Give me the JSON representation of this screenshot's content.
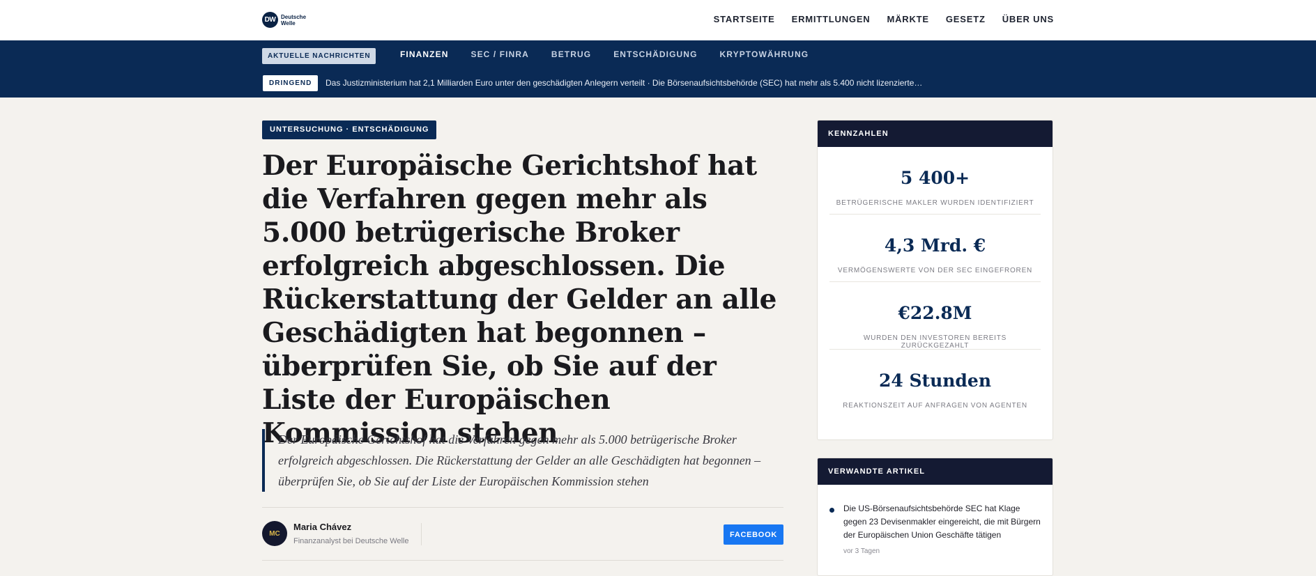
{
  "brand": {
    "mark": "DW",
    "name_line1": "Deutsche",
    "name_line2": "Welle",
    "color": "#0a2244"
  },
  "topnav": [
    {
      "label": "STARTSEITE"
    },
    {
      "label": "ERMITTLUNGEN"
    },
    {
      "label": "MÄRKTE"
    },
    {
      "label": "GESETZ"
    },
    {
      "label": "ÜBER UNS"
    }
  ],
  "subnav": {
    "latest_label": "AKTUELLE NACHRICHTEN",
    "categories": [
      {
        "label": "FINANZEN",
        "active": true
      },
      {
        "label": "SEC / FINRA"
      },
      {
        "label": "BETRUG"
      },
      {
        "label": "ENTSCHÄDIGUNG"
      },
      {
        "label": "KRYPTOWÄHRUNG"
      }
    ],
    "urgent_label": "DRINGEND",
    "ticker": "Das Justizministerium hat 2,1 Milliarden Euro unter den geschädigten Anlegern verteilt · Die Börsenaufsichtsbehörde (SEC) hat mehr als 5.400 nicht lizenzierte…"
  },
  "article": {
    "kicker": "UNTERSUCHUNG · ENTSCHÄDIGUNG",
    "headline": "Der Europäische Gerichtshof hat die Verfahren gegen mehr als 5.000 betrügerische Broker erfolgreich abgeschlossen. Die Rückerstattung der Gelder an alle Geschädigten hat begonnen – überprüfen Sie, ob Sie auf der Liste der Europäischen Kommission stehen",
    "lede": "Der Europäische Gerichtshof hat die Verfahren gegen mehr als 5.000 betrügerische Broker erfolgreich abgeschlossen. Die Rückerstattung der Gelder an alle Geschädigten hat begonnen – überprüfen Sie, ob Sie auf der Liste der Europäischen Kommission stehen",
    "author": {
      "initials": "MC",
      "name": "Maria Chávez",
      "role": "Finanzanalyst bei Deutsche Welle"
    },
    "share_facebook": "FACEBOOK"
  },
  "sidebar": {
    "stats_title": "KENNZAHLEN",
    "stats": [
      {
        "value": "5 400+",
        "label": "BETRÜGERISCHE MAKLER WURDEN IDENTIFIZIERT"
      },
      {
        "value": "4,3 Mrd. €",
        "label": "VERMÖGENSWERTE VON DER SEC EINGEFROREN"
      },
      {
        "value": "€22.8M",
        "label": "WURDEN DEN INVESTOREN BEREITS ZURÜCKGEZAHLT"
      },
      {
        "value": "24 Stunden",
        "label": "REAKTIONSZEIT AUF ANFRAGEN VON AGENTEN"
      }
    ],
    "related_title": "VERWANDTE ARTIKEL",
    "related": [
      {
        "title": "Die US-Börsenaufsichtsbehörde SEC hat Klage gegen 23 Devisenmakler eingereicht, die mit Bürgern der Europäischen Union Geschäfte tätigen",
        "time": "vor 3 Tagen"
      }
    ]
  },
  "colors": {
    "navy": "#0a2a55",
    "card_header": "#141a33",
    "facebook": "#1877f2",
    "page_bg": "#f4f2ee"
  }
}
